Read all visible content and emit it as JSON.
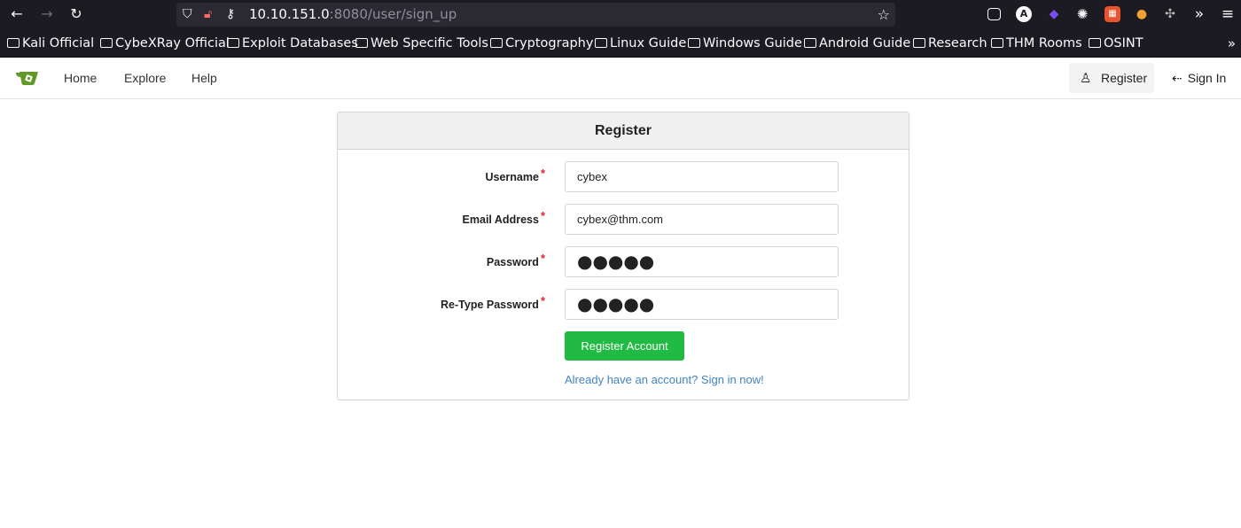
{
  "browser": {
    "url_host": "10.10.151.0",
    "url_rest": ":8080/user/sign_up",
    "bookmarks": [
      "Kali Official",
      "CybeXRay Official",
      "Exploit Databases",
      "Web Specific Tools",
      "Cryptography",
      "Linux Guide",
      "Windows Guide",
      "Android Guide",
      "Research",
      "THM Rooms",
      "OSINT"
    ]
  },
  "site_nav": {
    "home": "Home",
    "explore": "Explore",
    "help": "Help",
    "register": "Register",
    "sign_in": "Sign In"
  },
  "form": {
    "title": "Register",
    "username_label": "Username",
    "username_value": "cybex",
    "email_label": "Email Address",
    "email_value": "cybex@thm.com",
    "password_label": "Password",
    "password_masked": "●●●●●",
    "retype_label": "Re-Type Password",
    "retype_masked": "●●●●●",
    "required_marker": "*",
    "submit_label": "Register Account",
    "signin_link": "Already have an account? Sign in now!"
  },
  "colors": {
    "primary_button": "#21ba45",
    "link": "#4183c4",
    "required": "#db2828",
    "logo_green": "#609926"
  },
  "icons": [
    "back-arrow-icon",
    "forward-arrow-icon",
    "reload-icon",
    "shield-icon",
    "lock-icon",
    "key-icon",
    "bookmark-star-icon",
    "folder-icon",
    "user-icon",
    "sign-in-icon"
  ]
}
